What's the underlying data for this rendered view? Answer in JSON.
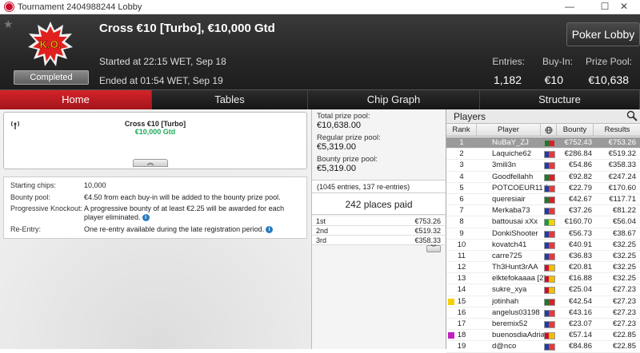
{
  "window": {
    "title": "Tournament 2404988244 Lobby",
    "controls": {
      "minimize": "—",
      "maximize": "☐",
      "close": "✕"
    }
  },
  "header": {
    "logo_text": "K.O.",
    "status": "Completed",
    "name": "Cross €10 [Turbo], €10,000 Gtd",
    "started": "Started at 22:15 WET, Sep 18",
    "ended": "Ended at 01:54 WET, Sep 19",
    "stats": [
      {
        "label": "Entries:",
        "value": "1,182"
      },
      {
        "label": "Buy-In:",
        "value": "€10"
      },
      {
        "label": "Prize Pool:",
        "value": "€10,638"
      }
    ],
    "lobby_button": "Poker Lobby"
  },
  "tabs": [
    {
      "label": "Home",
      "active": true
    },
    {
      "label": "Tables"
    },
    {
      "label": "Chip Graph"
    },
    {
      "label": "Structure"
    }
  ],
  "info_card": {
    "name": "Cross €10 [Turbo]",
    "guarantee": "€10,000 Gtd",
    "collapse": "︽"
  },
  "details": {
    "starting_chips": {
      "label": "Starting chips:",
      "value": "10,000"
    },
    "bounty_pool": {
      "label": "Bounty pool:",
      "value": "€4.50 from each buy-in will be added to the bounty prize pool."
    },
    "pko": {
      "label": "Progressive Knockout:",
      "value": "A progressive bounty of at least €2.25 will be awarded for each player eliminated."
    },
    "reentry": {
      "label": "Re-Entry:",
      "value": "One re-entry available during the late registration period."
    },
    "info_icon": "i"
  },
  "prizes": {
    "total_label": "Total prize pool:",
    "total": "€10,638.00",
    "regular_label": "Regular prize pool:",
    "regular": "€5,319.00",
    "bounty_label": "Bounty prize pool:",
    "bounty": "€5,319.00",
    "entries_note": "(1045 entries, 137 re-entries)",
    "places_paid": "242 places paid",
    "payouts": [
      {
        "place": "1st",
        "amount": "€753.26"
      },
      {
        "place": "2nd",
        "amount": "€519.32"
      },
      {
        "place": "3rd",
        "amount": "€358.33"
      }
    ],
    "expand": "︾"
  },
  "players": {
    "title": "Players",
    "columns": {
      "rank": "Rank",
      "player": "Player",
      "bounty": "Bounty",
      "results": "Results"
    },
    "rows": [
      {
        "rank": "1",
        "name": "NuBaY_ZJ",
        "flag": [
          "#1a7a2e",
          "#d5222a"
        ],
        "bounty": "€752.43",
        "result": "€753.26"
      },
      {
        "rank": "2",
        "name": "Laquiche62",
        "flag": [
          "#1d3fa5",
          "#e63a3a"
        ],
        "bounty": "€286.84",
        "result": "€519.32"
      },
      {
        "rank": "3",
        "name": "3mili3n",
        "flag": [
          "#1d3fa5",
          "#e63a3a"
        ],
        "bounty": "€54.86",
        "result": "€358.33"
      },
      {
        "rank": "4",
        "name": "Goodfellahh",
        "flag": [
          "#1a7a2e",
          "#d5222a"
        ],
        "bounty": "€92.82",
        "result": "€247.24"
      },
      {
        "rank": "5",
        "name": "POTCOEUR11 [2]",
        "flag": [
          "#1d3fa5",
          "#e63a3a"
        ],
        "bounty": "€22.79",
        "result": "€170.60"
      },
      {
        "rank": "6",
        "name": "queresiair",
        "flag": [
          "#1a7a2e",
          "#d5222a"
        ],
        "bounty": "€42.67",
        "result": "€117.71"
      },
      {
        "rank": "7",
        "name": "Merkaba73",
        "flag": [
          "#1d3fa5",
          "#e63a3a"
        ],
        "bounty": "€37.26",
        "result": "€81.22"
      },
      {
        "rank": "8",
        "name": "battousai xXx",
        "flag": [
          "#1a9a3a",
          "#f5d000"
        ],
        "bounty": "€160.70",
        "result": "€56.04"
      },
      {
        "rank": "9",
        "name": "DonkiShooter",
        "flag": [
          "#1d3fa5",
          "#e63a3a"
        ],
        "bounty": "€56.73",
        "result": "€38.67"
      },
      {
        "rank": "10",
        "name": "kovatch41",
        "flag": [
          "#1d3fa5",
          "#e63a3a"
        ],
        "bounty": "€40.91",
        "result": "€32.25"
      },
      {
        "rank": "11",
        "name": "carre725",
        "flag": [
          "#1d3fa5",
          "#e63a3a"
        ],
        "bounty": "€36.83",
        "result": "€32.25"
      },
      {
        "rank": "12",
        "name": "Th3Hunt3rAA",
        "flag": [
          "#c8102e",
          "#f1bf00"
        ],
        "bounty": "€20.81",
        "result": "€32.25"
      },
      {
        "rank": "13",
        "name": "elktefokaaaa [2]",
        "flag": [
          "#c8102e",
          "#f1bf00"
        ],
        "bounty": "€16.88",
        "result": "€32.25"
      },
      {
        "rank": "14",
        "name": "sukre_xya",
        "flag": [
          "#c8102e",
          "#f1bf00"
        ],
        "bounty": "€25.04",
        "result": "€27.23"
      },
      {
        "rank": "15",
        "name": "jotinhah",
        "flag": [
          "#1a7a2e",
          "#d5222a"
        ],
        "bounty": "€42.54",
        "result": "€27.23",
        "marker": "#f5d000"
      },
      {
        "rank": "16",
        "name": "angelus03198",
        "flag": [
          "#1d3fa5",
          "#e63a3a"
        ],
        "bounty": "€43.16",
        "result": "€27.23"
      },
      {
        "rank": "17",
        "name": "beremix52",
        "flag": [
          "#1d3fa5",
          "#e63a3a"
        ],
        "bounty": "€23.07",
        "result": "€27.23"
      },
      {
        "rank": "18",
        "name": "buenosdiaAdrian",
        "flag": [
          "#c8102e",
          "#f1bf00"
        ],
        "bounty": "€57.14",
        "result": "€22.85",
        "marker": "#c020c0"
      },
      {
        "rank": "19",
        "name": "d@nco",
        "flag": [
          "#1d3fa5",
          "#e63a3a"
        ],
        "bounty": "€84.86",
        "result": "€22.85"
      }
    ]
  }
}
